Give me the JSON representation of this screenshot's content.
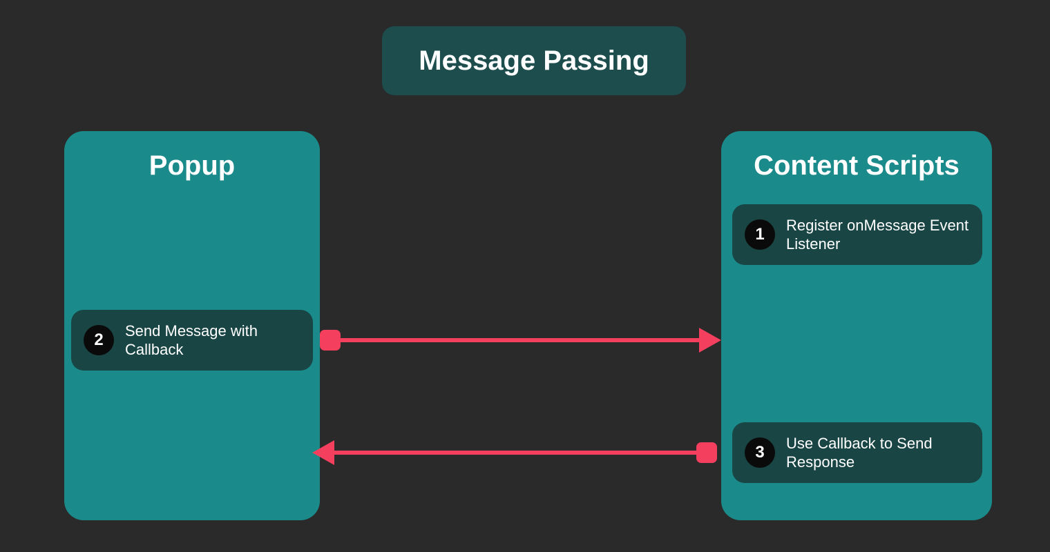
{
  "title": "Message Passing",
  "left_panel": {
    "title": "Popup"
  },
  "right_panel": {
    "title": "Content Scripts"
  },
  "steps": {
    "s1": {
      "num": "1",
      "label": "Register onMessage Event Listener"
    },
    "s2": {
      "num": "2",
      "label": "Send Message with Callback"
    },
    "s3": {
      "num": "3",
      "label": "Use Callback to Send Response"
    }
  },
  "colors": {
    "accent": "#f43f5e",
    "panel": "#1a8a8a",
    "bg": "#2a2a2a"
  }
}
